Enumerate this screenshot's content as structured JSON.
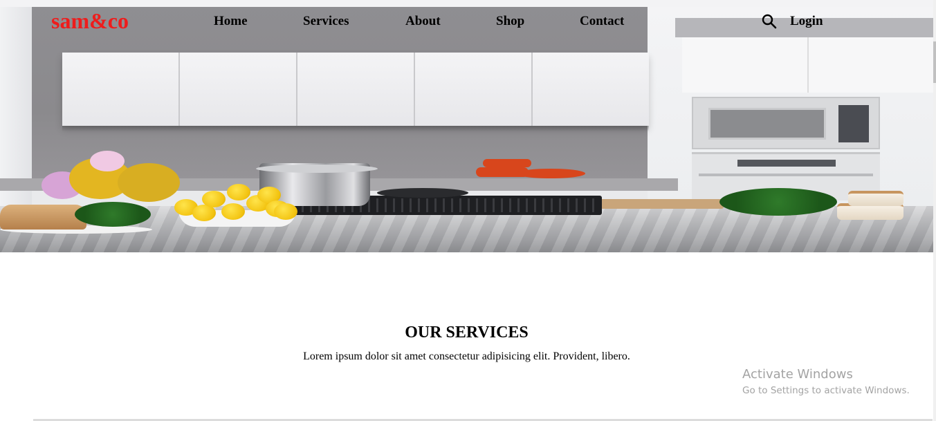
{
  "brand": {
    "logo_text": "sam&co",
    "logo_color": "#ee1c1c"
  },
  "nav": {
    "items": [
      {
        "label": "Home"
      },
      {
        "label": "Services"
      },
      {
        "label": "About"
      },
      {
        "label": "Shop"
      },
      {
        "label": "Contact"
      }
    ],
    "search_icon": "search-icon",
    "login_label": "Login"
  },
  "hero": {
    "image": "kitchen-counter-photo"
  },
  "services": {
    "title": "OUR SERVICES",
    "text": "Lorem ipsum dolor sit amet consectetur adipisicing elit. Provident, libero."
  },
  "watermark": {
    "title": "Activate Windows",
    "subtitle": "Go to Settings to activate Windows."
  }
}
